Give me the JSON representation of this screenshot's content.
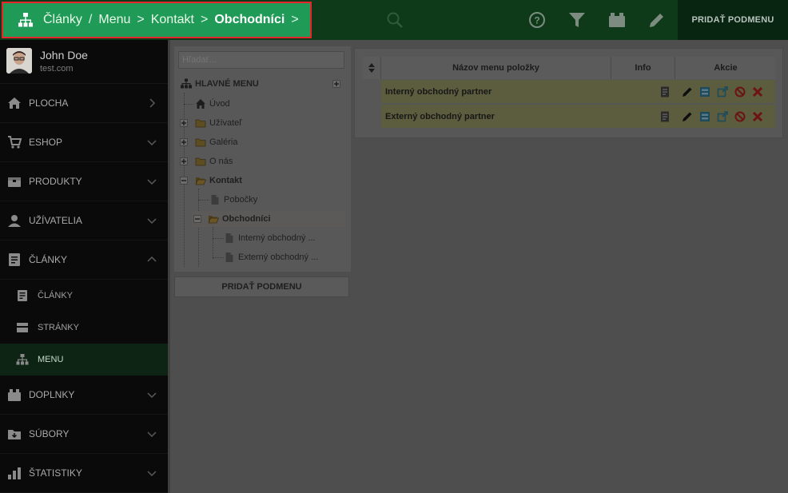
{
  "breadcrumb": {
    "items": [
      "Články",
      "Menu",
      "Kontakt",
      "Obchodníci"
    ],
    "sep_first": "/",
    "sep": ">"
  },
  "toolbar": {
    "icons": [
      "search-icon",
      "help-icon",
      "filter-icon",
      "inbox-icon",
      "pencil-icon"
    ],
    "add_submenu_label": "PRIDAŤ PODMENU"
  },
  "user": {
    "name": "John Doe",
    "email": "test.com"
  },
  "sidebar": {
    "items": [
      {
        "label": "PLOCHA",
        "icon": "home-icon"
      },
      {
        "label": "ESHOP",
        "icon": "cart-icon"
      },
      {
        "label": "PRODUKTY",
        "icon": "box-icon"
      },
      {
        "label": "UŽÍVATELIA",
        "icon": "user-icon"
      },
      {
        "label": "ČLÁNKY",
        "icon": "article-icon"
      }
    ],
    "sub_items": [
      {
        "label": "ČLÁNKY",
        "icon": "article-icon"
      },
      {
        "label": "STRÁNKY",
        "icon": "pages-icon"
      },
      {
        "label": "MENU",
        "icon": "sitemap-icon",
        "active": true
      }
    ],
    "bottom_items": [
      {
        "label": "DOPLNKY",
        "icon": "addons-icon"
      },
      {
        "label": "SÚBORY",
        "icon": "files-icon"
      },
      {
        "label": "ŠTATISTIKY",
        "icon": "stats-icon"
      }
    ]
  },
  "tree": {
    "search_placeholder": "Hľadať...",
    "root": "HLAVNÉ MENU",
    "nodes": [
      "Úvod",
      "Užívateľ",
      "Galéria",
      "O nás",
      "Kontakt",
      "Pobočky",
      "Obchodníci",
      "Interný obchodný ...",
      "Externý obchodný ..."
    ],
    "add_submenu_label": "PRIDAŤ PODMENU"
  },
  "table": {
    "headers": [
      "Názov menu položky",
      "Info",
      "Akcie"
    ],
    "rows": [
      "Interný obchodný partner",
      "Externý obchodný partner"
    ],
    "row_color": "#5b5d3e"
  },
  "colors": {
    "accent": "#1f9a57",
    "highlight_border": "#e8242c",
    "topbar": "#0e3a1a"
  }
}
